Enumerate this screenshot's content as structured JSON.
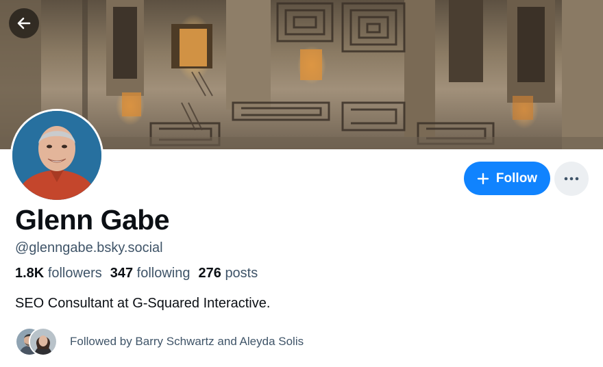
{
  "header": {
    "back_icon": "arrow-left-icon"
  },
  "profile": {
    "display_name": "Glenn Gabe",
    "handle": "@glenngabe.bsky.social",
    "bio": "SEO Consultant at G-Squared Interactive."
  },
  "stats": {
    "followers_count": "1.8K",
    "followers_label": "followers",
    "following_count": "347",
    "following_label": "following",
    "posts_count": "276",
    "posts_label": "posts"
  },
  "actions": {
    "follow_label": "Follow",
    "follow_icon": "plus-icon",
    "more_icon": "more-dots-icon"
  },
  "known_followers": {
    "text": "Followed by Barry Schwartz and Aleyda Solis"
  },
  "colors": {
    "accent": "#1083fe",
    "secondary_text": "#3f5468",
    "more_button_bg": "#eceff2"
  }
}
